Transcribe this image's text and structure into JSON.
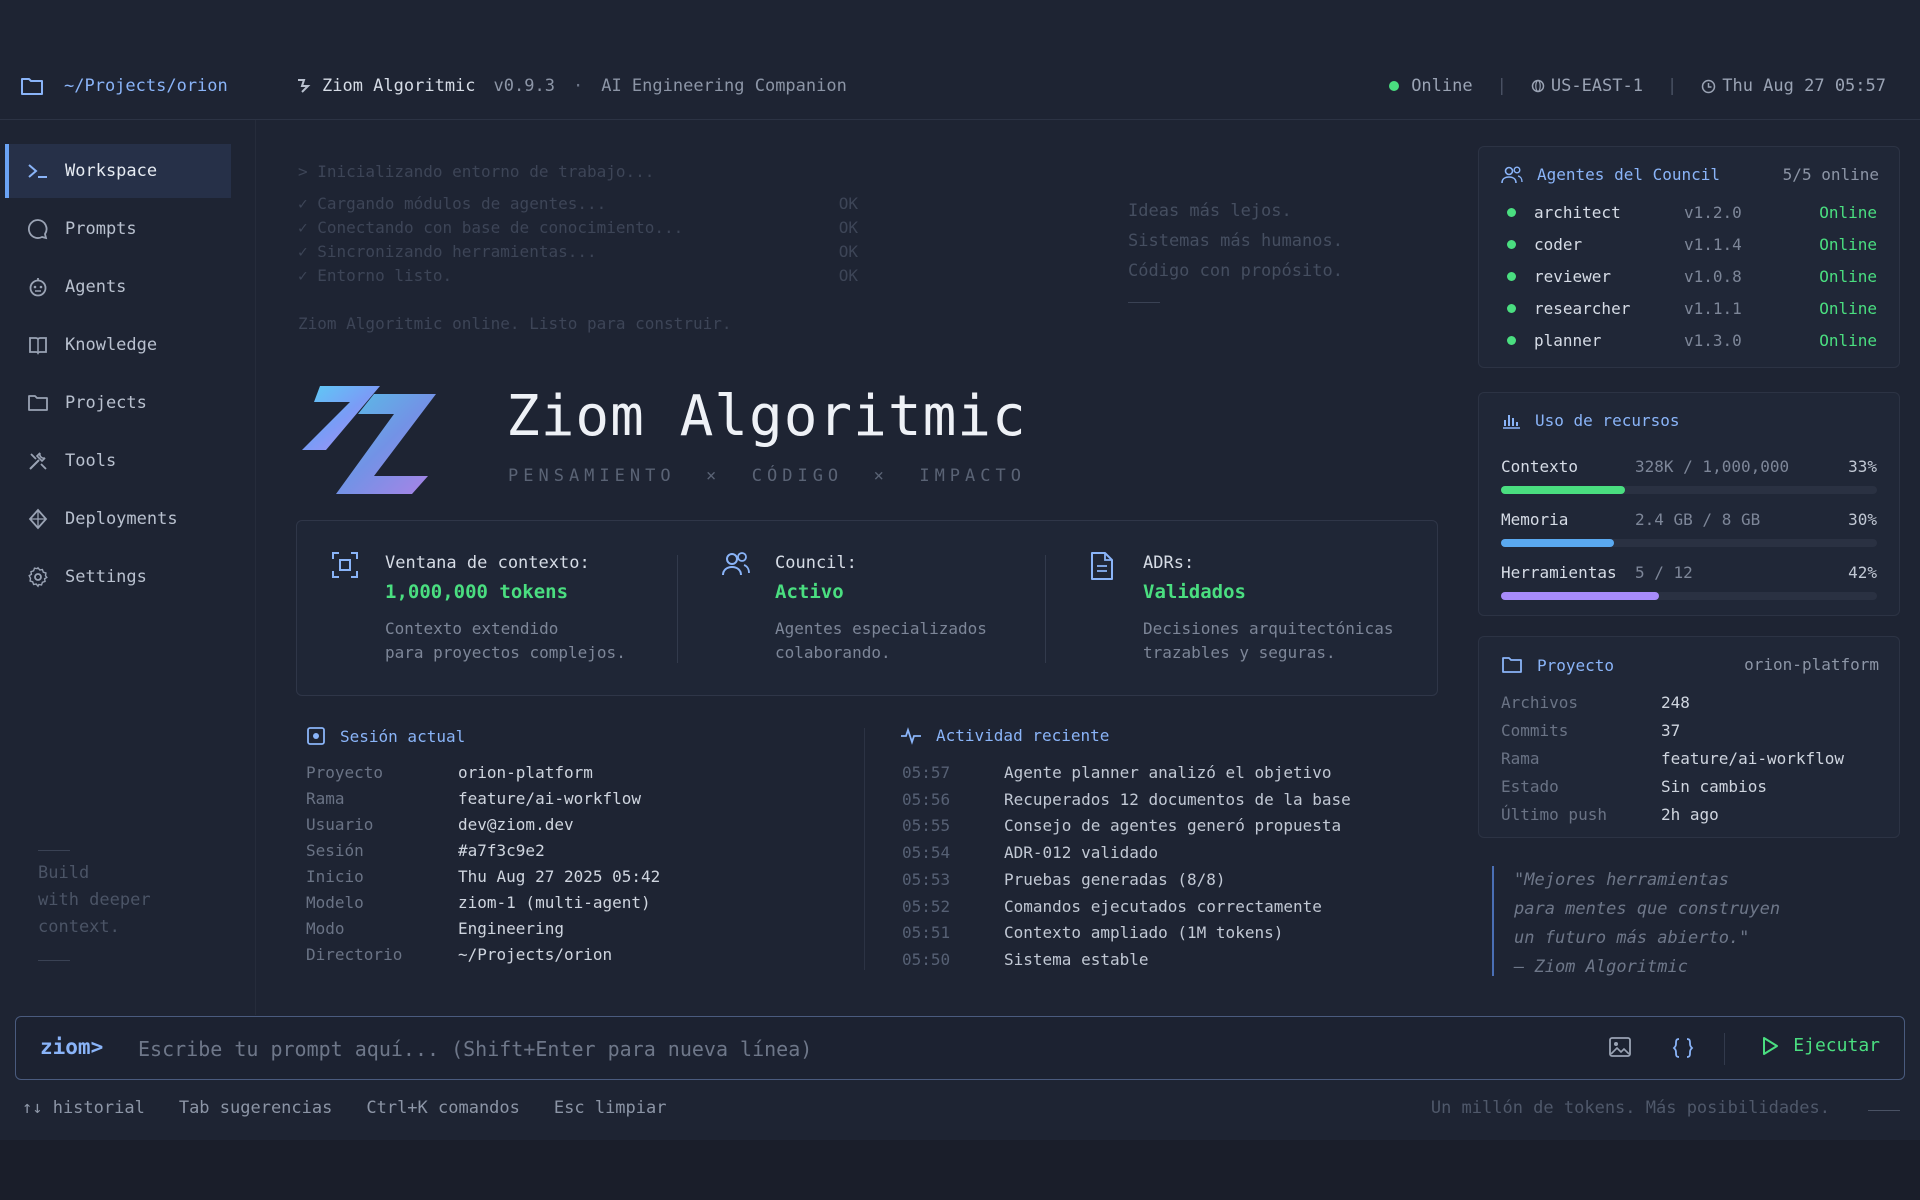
{
  "topbar": {
    "path": "~/Projects/orion",
    "brand": "Ziom Algoritmic",
    "version": "v0.9.3",
    "separator": "·",
    "tagline": "AI Engineering Companion",
    "status": "Online",
    "region": "US-EAST-1",
    "datetime": "Thu Aug 27 05:57"
  },
  "sidebar": {
    "items": [
      {
        "label": "Workspace",
        "icon": "terminal-icon"
      },
      {
        "label": "Prompts",
        "icon": "chat-icon"
      },
      {
        "label": "Agents",
        "icon": "robot-icon"
      },
      {
        "label": "Knowledge",
        "icon": "book-icon"
      },
      {
        "label": "Projects",
        "icon": "folder-icon"
      },
      {
        "label": "Tools",
        "icon": "tools-icon"
      },
      {
        "label": "Deployments",
        "icon": "deploy-icon"
      },
      {
        "label": "Settings",
        "icon": "gear-icon"
      }
    ],
    "note": [
      "Build",
      "with deeper",
      "context."
    ]
  },
  "boot": {
    "header": "> Inicializando entorno de trabajo...",
    "lines": [
      {
        "text": "✓ Cargando módulos de agentes...",
        "status": "OK"
      },
      {
        "text": "✓ Conectando con base de conocimiento...",
        "status": "OK"
      },
      {
        "text": "✓ Sincronizando herramientas...",
        "status": "OK"
      },
      {
        "text": "✓ Entorno listo.",
        "status": "OK"
      }
    ],
    "footer": "Ziom Algoritmic online. Listo para construir."
  },
  "motto": [
    "Ideas más lejos.",
    "Sistemas más humanos.",
    "Código con propósito."
  ],
  "hero": {
    "title": "Ziom Algoritmic",
    "subtitle": "PENSAMIENTO  ×  CÓDIGO  ×  IMPACTO"
  },
  "features": [
    {
      "label": "Ventana de contexto:",
      "value": "1,000,000 tokens",
      "desc1": "Contexto extendido",
      "desc2": "para proyectos complejos."
    },
    {
      "label": "Council:",
      "value": "Activo",
      "desc1": "Agentes especializados",
      "desc2": "colaborando."
    },
    {
      "label": "ADRs:",
      "value": "Validados",
      "desc1": "Decisiones arquitectónicas",
      "desc2": "trazables y seguras."
    }
  ],
  "session": {
    "title": "Sesión actual",
    "rows": [
      {
        "k": "Proyecto",
        "v": "orion-platform"
      },
      {
        "k": "Rama",
        "v": "feature/ai-workflow"
      },
      {
        "k": "Usuario",
        "v": "dev@ziom.dev"
      },
      {
        "k": "Sesión",
        "v": "#a7f3c9e2"
      },
      {
        "k": "Inicio",
        "v": "Thu Aug 27 2025 05:42"
      },
      {
        "k": "Modelo",
        "v": "ziom-1 (multi-agent)"
      },
      {
        "k": "Modo",
        "v": "Engineering"
      },
      {
        "k": "Directorio",
        "v": "~/Projects/orion"
      }
    ]
  },
  "activity": {
    "title": "Actividad reciente",
    "rows": [
      {
        "t": "05:57",
        "m": "Agente planner analizó el objetivo"
      },
      {
        "t": "05:56",
        "m": "Recuperados 12 documentos de la base"
      },
      {
        "t": "05:55",
        "m": "Consejo de agentes generó propuesta"
      },
      {
        "t": "05:54",
        "m": "ADR-012 validado"
      },
      {
        "t": "05:53",
        "m": "Pruebas generadas (8/8)"
      },
      {
        "t": "05:52",
        "m": "Comandos ejecutados correctamente"
      },
      {
        "t": "05:51",
        "m": "Contexto ampliado (1M tokens)"
      },
      {
        "t": "05:50",
        "m": "Sistema estable"
      }
    ]
  },
  "council": {
    "title": "Agentes del Council",
    "count": "5/5 online",
    "agents": [
      {
        "name": "architect",
        "version": "v1.2.0",
        "status": "Online"
      },
      {
        "name": "coder",
        "version": "v1.1.4",
        "status": "Online"
      },
      {
        "name": "reviewer",
        "version": "v1.0.8",
        "status": "Online"
      },
      {
        "name": "researcher",
        "version": "v1.1.1",
        "status": "Online"
      },
      {
        "name": "planner",
        "version": "v1.3.0",
        "status": "Online"
      }
    ]
  },
  "resources": {
    "title": "Uso de recursos",
    "rows": [
      {
        "name": "Contexto",
        "amount": "328K / 1,000,000",
        "pct": "33%",
        "value": 0.33,
        "color": "#4ade80"
      },
      {
        "name": "Memoria",
        "amount": "2.4 GB / 8 GB",
        "pct": "30%",
        "value": 0.3,
        "color": "#5aa9f0"
      },
      {
        "name": "Herramientas",
        "amount": "5 / 12",
        "pct": "42%",
        "value": 0.42,
        "color": "#a78bfa"
      }
    ]
  },
  "project": {
    "title": "Proyecto",
    "name": "orion-platform",
    "rows": [
      {
        "k": "Archivos",
        "v": "248"
      },
      {
        "k": "Commits",
        "v": "37"
      },
      {
        "k": "Rama",
        "v": "feature/ai-workflow"
      },
      {
        "k": "Estado",
        "v": "Sin cambios"
      },
      {
        "k": "Último push",
        "v": "2h ago"
      }
    ]
  },
  "quote": {
    "lines": [
      "\"Mejores herramientas",
      "para mentes que construyen",
      "un futuro más abierto.\""
    ],
    "author": "— Ziom Algoritmic"
  },
  "prompt": {
    "ps": "ziom>",
    "placeholder": "Escribe tu prompt aquí... (Shift+Enter para nueva línea)",
    "run": "Ejecutar"
  },
  "hints": [
    "↑↓ historial",
    "Tab sugerencias",
    "Ctrl+K comandos",
    "Esc limpiar"
  ],
  "footer_tagline": "Un millón de tokens. Más posibilidades."
}
